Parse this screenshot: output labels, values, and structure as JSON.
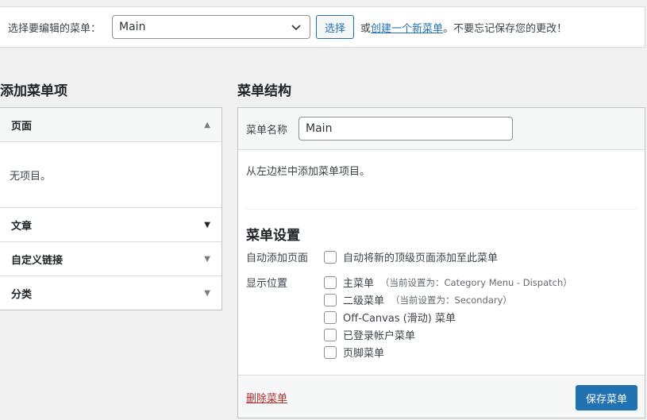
{
  "topbar": {
    "label": "选择要编辑的菜单：",
    "selected_menu": "Main",
    "select_button": "选择",
    "or_text": "或",
    "create_link": "创建一个新菜单",
    "reminder": "。不要忘记保存您的更改！"
  },
  "left": {
    "title": "添加菜单项",
    "sections": [
      {
        "label": "页面",
        "empty_text": "无项目。"
      },
      {
        "label": "文章"
      },
      {
        "label": "自定义链接"
      },
      {
        "label": "分类"
      }
    ]
  },
  "right": {
    "title": "菜单结构",
    "name_label": "菜单名称",
    "name_value": "Main",
    "hint": "从左边栏中添加菜单项目。",
    "settings_title": "菜单设置",
    "auto_add_label": "自动添加页面",
    "auto_add_option": "自动将新的顶级页面添加至此菜单",
    "location_label": "显示位置",
    "locations": [
      {
        "label": "主菜单",
        "note": "（当前设置为：Category Menu - Dispatch）"
      },
      {
        "label": "二级菜单",
        "note": "（当前设置为：Secondary）"
      },
      {
        "label": "Off-Canvas (滑动) 菜单",
        "note": ""
      },
      {
        "label": "已登录帐户菜单",
        "note": ""
      },
      {
        "label": "页脚菜单",
        "note": ""
      }
    ],
    "delete_link": "删除菜单",
    "save_button": "保存菜单"
  }
}
